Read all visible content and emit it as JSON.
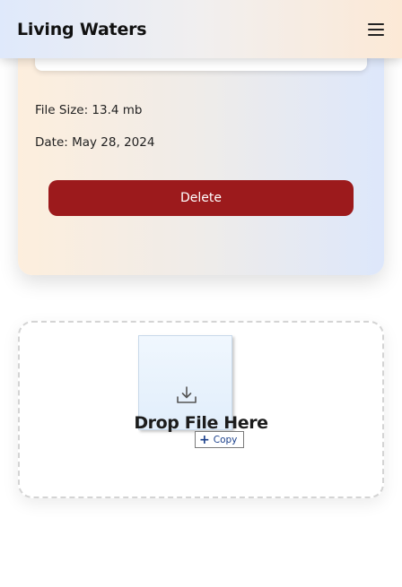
{
  "header": {
    "brand": "Living Waters",
    "menu_icon": "hamburger-menu-icon"
  },
  "file_card": {
    "file_size_label": "File Size: 13.4 mb",
    "date_label": "Date: May 28, 2024",
    "delete_label": "Delete",
    "delete_color": "#9c1a1c"
  },
  "drop_zone": {
    "label": "Drop File Here",
    "drag_icon": "download-tray-icon",
    "copy_cursor_label": "Copy",
    "copy_cursor_icon": "plus-icon"
  }
}
